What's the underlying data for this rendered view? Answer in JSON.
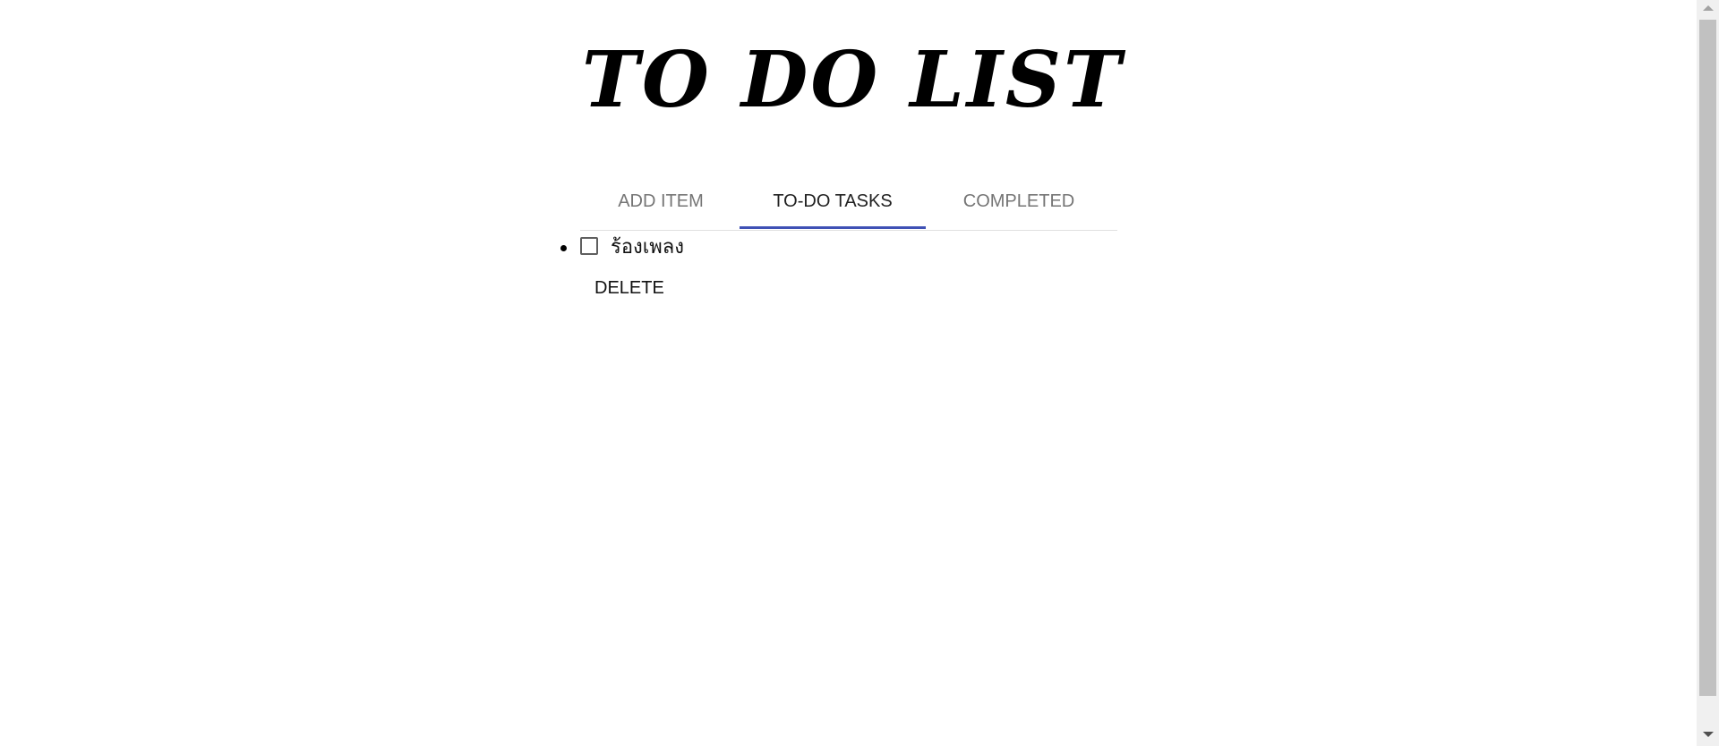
{
  "app": {
    "title": "TO DO LIST"
  },
  "tabs": [
    {
      "label": "ADD ITEM",
      "active": false
    },
    {
      "label": "TO-DO TASKS",
      "active": true
    },
    {
      "label": "COMPLETED",
      "active": false
    }
  ],
  "tasks": [
    {
      "label": "ร้องเพลง",
      "checked": false
    }
  ],
  "actions": {
    "delete_label": "DELETE"
  },
  "colors": {
    "accent": "#3f51b5",
    "tab_inactive": "#757575",
    "tab_active": "#212121"
  }
}
